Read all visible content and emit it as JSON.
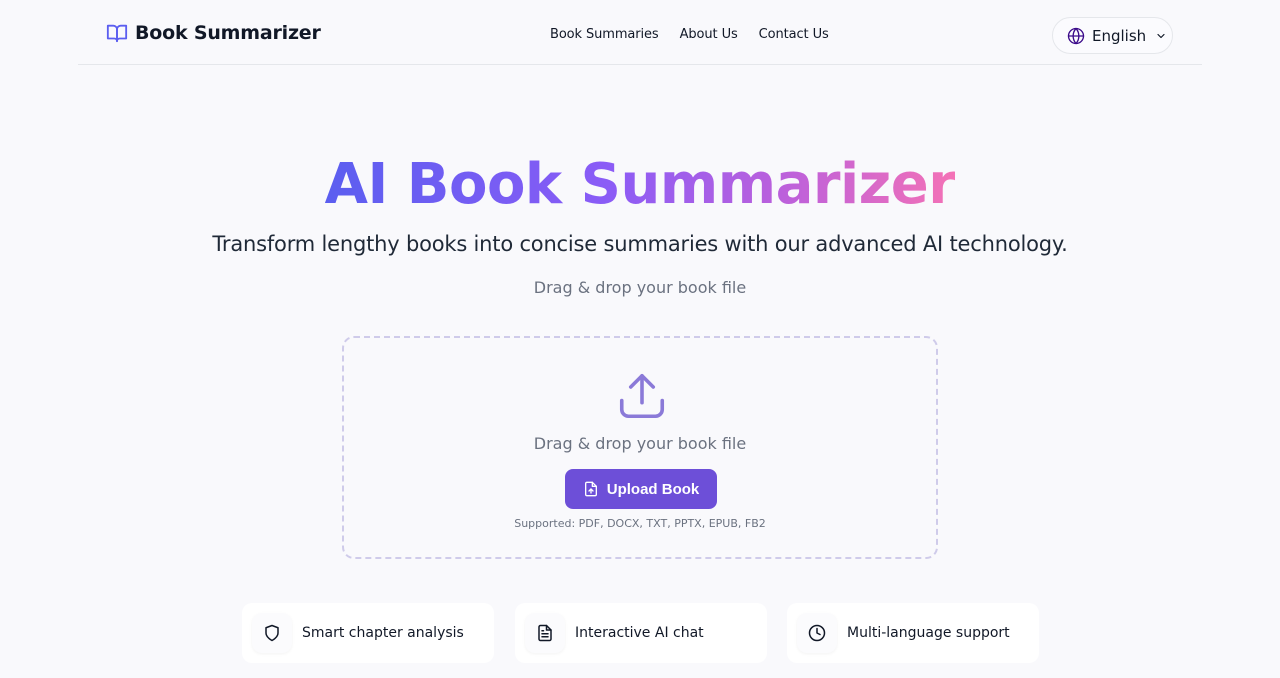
{
  "header": {
    "brand": "Book Summarizer",
    "nav": [
      "Book Summaries",
      "About Us",
      "Contact Us"
    ],
    "language": "English"
  },
  "hero": {
    "title": "AI Book Summarizer",
    "subtitle": "Transform lengthy books into concise summaries with our advanced AI technology.",
    "drag_hint": "Drag & drop your book file"
  },
  "dropzone": {
    "text": "Drag & drop your book file",
    "button_label": "Upload Book",
    "supported": "Supported: PDF, DOCX, TXT, PPTX, EPUB, FB2"
  },
  "features": [
    {
      "label": "Smart chapter analysis",
      "icon": "shield-icon"
    },
    {
      "label": "Interactive AI chat",
      "icon": "document-icon"
    },
    {
      "label": "Multi-language support",
      "icon": "clock-icon"
    }
  ],
  "colors": {
    "accent": "#6d4fd8",
    "gradient_start": "#5b5ef0",
    "gradient_end": "#f472b6"
  }
}
